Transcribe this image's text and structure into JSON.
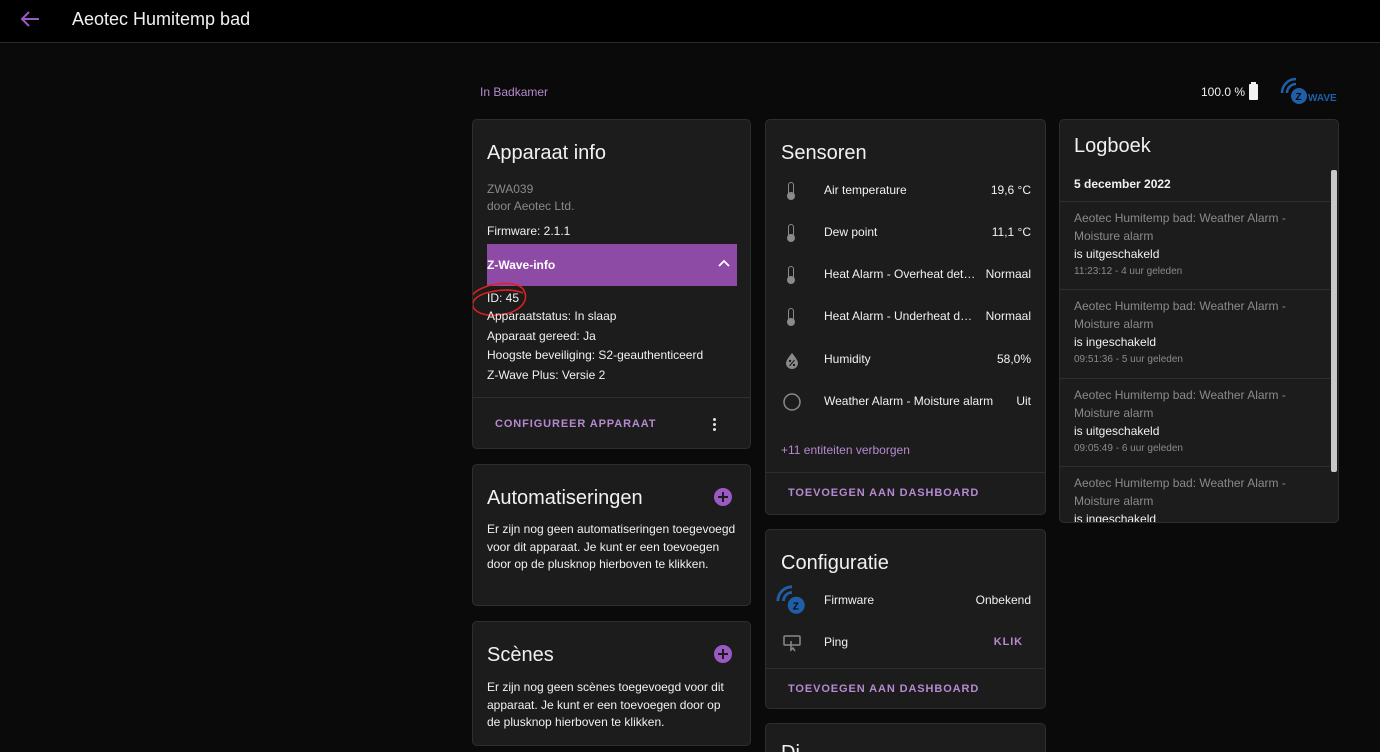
{
  "header": {
    "title": "Aeotec Humitemp bad",
    "back_icon": "arrow-left-icon",
    "accent": "#9b59c4"
  },
  "area": {
    "link": "In Badkamer"
  },
  "battery": {
    "level": "100.0 %"
  },
  "brand": {
    "logo": "Z-WAVE"
  },
  "device_info": {
    "title": "Apparaat info",
    "model": "ZWA039",
    "manufacturer": "door Aeotec Ltd.",
    "firmware": "Firmware: 2.1.1",
    "zwave_header": "Z-Wave-info",
    "id": "ID: 45",
    "status": "Apparaatstatus: In slaap",
    "ready": "Apparaat gereed: Ja",
    "security": "Hoogste beveiliging: S2-geauthenticeerd",
    "zwave_plus": "Z-Wave Plus: Versie 2",
    "configure": "CONFIGUREER APPARAAT"
  },
  "automations": {
    "title": "Automatiseringen",
    "text": "Er zijn nog geen automatiseringen toegevoegd voor dit apparaat. Je kunt er een toevoegen door op de plusknop hierboven te klikken."
  },
  "scenes": {
    "title": "Scènes",
    "text": "Er zijn nog geen scènes toegevoegd voor dit apparaat. Je kunt er een toevoegen door op de plusknop hierboven te klikken."
  },
  "sensors": {
    "title": "Sensoren",
    "items": [
      {
        "label": "Air temperature",
        "value": "19,6 °C",
        "icon": "thermometer-icon"
      },
      {
        "label": "Dew point",
        "value": "11,1 °C",
        "icon": "thermometer-icon"
      },
      {
        "label": "Heat Alarm - Overheat detected",
        "value": "Normaal",
        "icon": "thermometer-icon"
      },
      {
        "label": "Heat Alarm - Underheat detected",
        "value": "Normaal",
        "icon": "thermometer-icon"
      },
      {
        "label": "Humidity",
        "value": "58,0%",
        "icon": "water-percent-icon"
      },
      {
        "label": "Weather Alarm - Moisture alarm",
        "value": "Uit",
        "icon": "circle-outline-icon"
      }
    ],
    "hidden": "+11 entiteiten verborgen",
    "add": "TOEVOEGEN AAN DASHBOARD"
  },
  "config": {
    "title": "Configuratie",
    "firmware_label": "Firmware",
    "firmware_value": "Onbekend",
    "ping_label": "Ping",
    "ping_action": "KLIK",
    "add": "TOEVOEGEN AAN DASHBOARD"
  },
  "diagnostics": {
    "title": "Di"
  },
  "logbook": {
    "title": "Logboek",
    "date": "5 december 2022",
    "entries": [
      {
        "source": "Aeotec Humitemp bad: Weather Alarm - Moisture alarm",
        "state": "is uitgeschakeld",
        "when": "11:23:12 - 4 uur geleden"
      },
      {
        "source": "Aeotec Humitemp bad: Weather Alarm - Moisture alarm",
        "state": "is ingeschakeld",
        "when": "09:51:36 - 5 uur geleden"
      },
      {
        "source": "Aeotec Humitemp bad: Weather Alarm - Moisture alarm",
        "state": "is uitgeschakeld",
        "when": "09:05:49 - 6 uur geleden"
      },
      {
        "source": "Aeotec Humitemp bad: Weather Alarm - Moisture alarm",
        "state": "is ingeschakeld",
        "when": ""
      }
    ]
  }
}
